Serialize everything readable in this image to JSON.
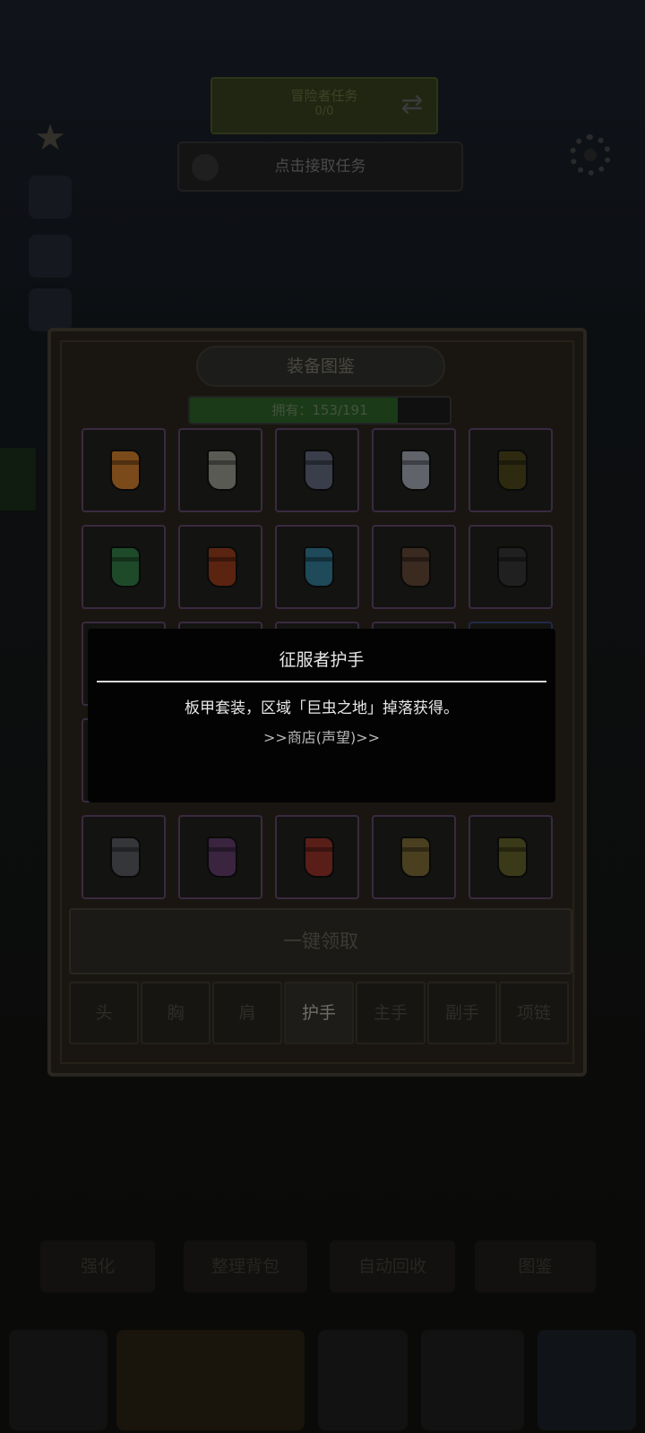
{
  "hud": {
    "task_top_line1": "冒险者任务",
    "task_top_line2": "0/0",
    "task_bar_label": "点击接取任务"
  },
  "panel": {
    "title": "装备图鉴",
    "owned_text": "拥有：153/191",
    "owned_fraction": 0.801
  },
  "grid": [
    {
      "color": "#7a4a1a",
      "blue": false
    },
    {
      "color": "#5a5a55",
      "blue": false
    },
    {
      "color": "#3a3d4a",
      "blue": false
    },
    {
      "color": "#60636a",
      "blue": false
    },
    {
      "color": "#2d2a10",
      "blue": false
    },
    {
      "color": "#1e4a2a",
      "blue": false
    },
    {
      "color": "#5a2410",
      "blue": false
    },
    {
      "color": "#1e4a5a",
      "blue": false
    },
    {
      "color": "#3a2a20",
      "blue": false
    },
    {
      "color": "#202020",
      "blue": false
    },
    {
      "color": "#151515",
      "blue": false
    },
    {
      "color": "#151515",
      "blue": false
    },
    {
      "color": "#151515",
      "blue": false
    },
    {
      "color": "#151515",
      "blue": false
    },
    {
      "color": "#151515",
      "blue": true
    },
    {
      "color": "#151515",
      "blue": false
    },
    {
      "color": "#151515",
      "blue": false
    },
    {
      "color": "#151515",
      "blue": true
    },
    {
      "color": "#151515",
      "blue": false
    },
    {
      "color": "#151515",
      "blue": true
    },
    {
      "color": "#34363a",
      "blue": false
    },
    {
      "color": "#3a2440",
      "blue": false
    },
    {
      "color": "#5a1e18",
      "blue": false
    },
    {
      "color": "#4a4020",
      "blue": false
    },
    {
      "color": "#3a3a18",
      "blue": false
    }
  ],
  "tooltip": {
    "title": "征服者护手",
    "description": "板甲套装，区域「巨虫之地」掉落获得。",
    "link": ">>商店(声望)>>"
  },
  "claim_all": "一键领取",
  "tabs": [
    {
      "label": "头",
      "active": false
    },
    {
      "label": "胸",
      "active": false
    },
    {
      "label": "肩",
      "active": false
    },
    {
      "label": "护手",
      "active": true
    },
    {
      "label": "主手",
      "active": false
    },
    {
      "label": "副手",
      "active": false
    },
    {
      "label": "项链",
      "active": false
    }
  ],
  "bottom_buttons": [
    "强化",
    "整理背包",
    "自动回收",
    "图鉴"
  ]
}
